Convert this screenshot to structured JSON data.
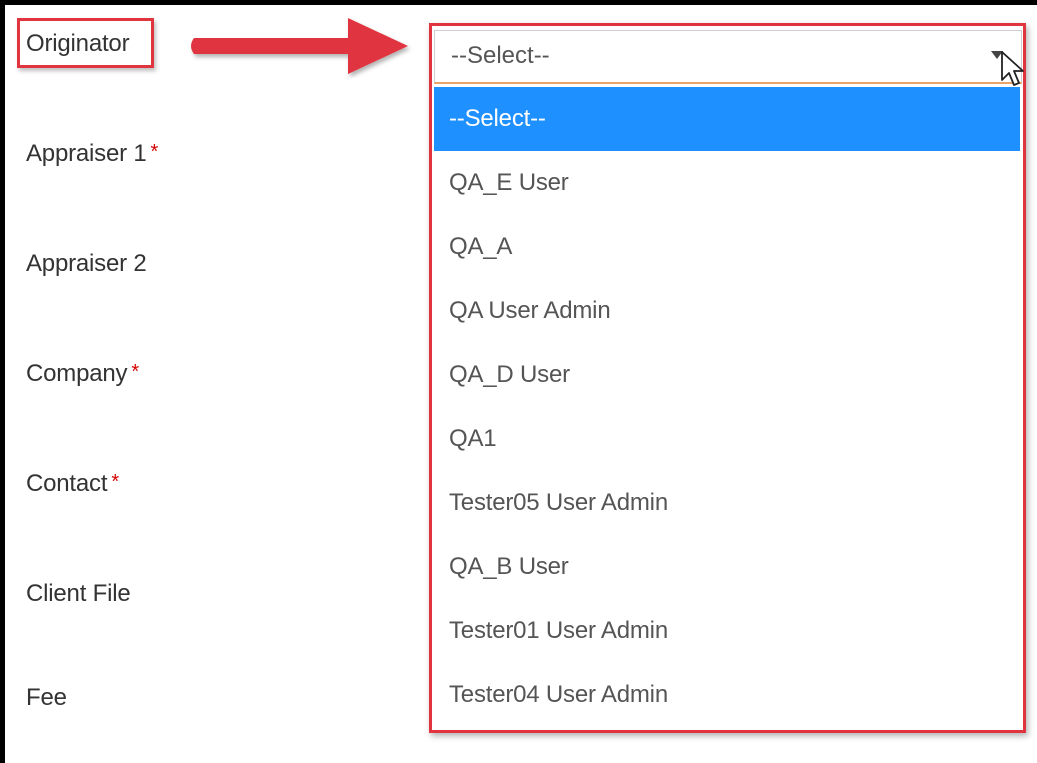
{
  "form": {
    "fields": [
      {
        "label": "Originator",
        "required": false
      },
      {
        "label": "Appraiser 1",
        "required": true
      },
      {
        "label": "Appraiser 2",
        "required": false
      },
      {
        "label": "Company",
        "required": true
      },
      {
        "label": "Contact",
        "required": true
      },
      {
        "label": "Client File",
        "required": false
      },
      {
        "label": "Fee",
        "required": false
      }
    ],
    "required_marker": "*"
  },
  "originator_select": {
    "value": "--Select--",
    "options": [
      "--Select--",
      "QA_E User",
      "QA_A",
      "QA User Admin",
      "QA_D User",
      "QA1",
      "Tester05 User Admin",
      "QA_B User",
      "Tester01 User Admin",
      "Tester04 User Admin"
    ],
    "highlighted_index": 0
  },
  "colors": {
    "annotation_red": "#e0353f",
    "selected_option_bg": "#1e90ff",
    "required_red": "#d40000"
  },
  "icons": {
    "pointer": "cursor-arrow-icon",
    "caret": "chevron-down-icon",
    "annotation": "red-arrow-icon"
  }
}
